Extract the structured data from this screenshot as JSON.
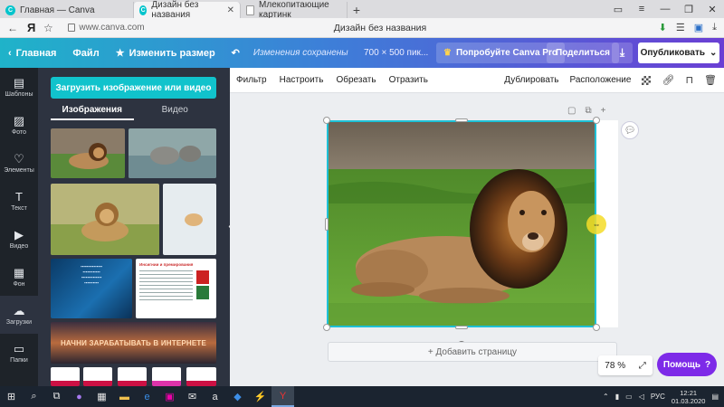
{
  "browser": {
    "tabs": [
      {
        "title": "Главная — Canva",
        "active": false
      },
      {
        "title": "Дизайн без названия",
        "active": true
      },
      {
        "title": "Млекопитающие картинк",
        "active": false
      }
    ],
    "url": "www.canva.com",
    "page_title": "Дизайн без названия"
  },
  "toolbar": {
    "home": "Главная",
    "file": "Файл",
    "resize": "Изменить размер",
    "saved_status": "Изменения сохранены",
    "size": "700 × 500 пик...",
    "pro": "Попробуйте Canva Pro",
    "share": "Поделиться",
    "publish": "Опубликовать"
  },
  "rail": {
    "items": [
      {
        "label": "Шаблоны",
        "icon": "templates-icon"
      },
      {
        "label": "Фото",
        "icon": "photo-icon"
      },
      {
        "label": "Элементы",
        "icon": "elements-icon"
      },
      {
        "label": "Текст",
        "icon": "text-icon"
      },
      {
        "label": "Видео",
        "icon": "video-icon"
      },
      {
        "label": "Фон",
        "icon": "background-icon"
      },
      {
        "label": "Загрузки",
        "icon": "upload-icon"
      },
      {
        "label": "Папки",
        "icon": "folder-icon"
      }
    ]
  },
  "panel": {
    "upload_button": "Загрузить изображение или видео",
    "tab_images": "Изображения",
    "tab_video": "Видео",
    "banner_text": "НАЧНИ ЗАРАБАТЫВАТЬ В ИНТЕРНЕТЕ",
    "doc_title": "Инсигнии и премирования"
  },
  "subtoolbar": {
    "filter": "Фильтр",
    "adjust": "Настроить",
    "crop": "Обрезать",
    "flip": "Отразить",
    "duplicate": "Дублировать",
    "arrange": "Расположение"
  },
  "canvas": {
    "add_page": "+ Добавить страницу",
    "zoom": "78 %",
    "help": "Помощь"
  },
  "taskbar": {
    "lang": "РУС",
    "time": "12:21",
    "date": "01.03.2020"
  }
}
